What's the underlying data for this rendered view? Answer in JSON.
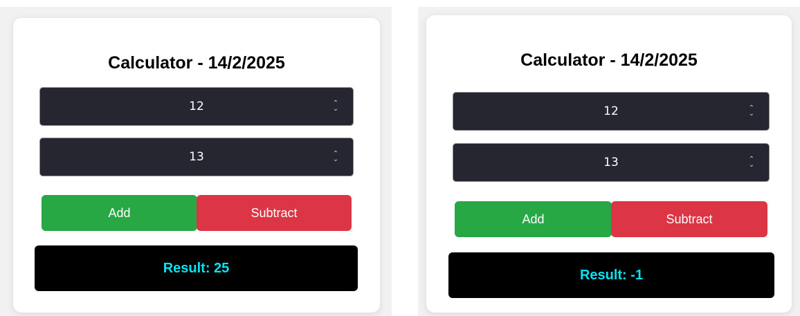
{
  "panels": [
    {
      "title": "Calculator - 14/2/2025",
      "input_a": "12",
      "input_b": "13",
      "add_label": "Add",
      "subtract_label": "Subtract",
      "result": "Result: 25"
    },
    {
      "title": "Calculator - 14/2/2025",
      "input_a": "12",
      "input_b": "13",
      "add_label": "Add",
      "subtract_label": "Subtract",
      "result": "Result: -1"
    }
  ],
  "icons": {
    "spinner": "spinner-updown-icon"
  },
  "colors": {
    "add": "#28a745",
    "subtract": "#dc3545",
    "result_bg": "#000000",
    "result_text": "#00e5f2",
    "input_bg": "#262631"
  }
}
